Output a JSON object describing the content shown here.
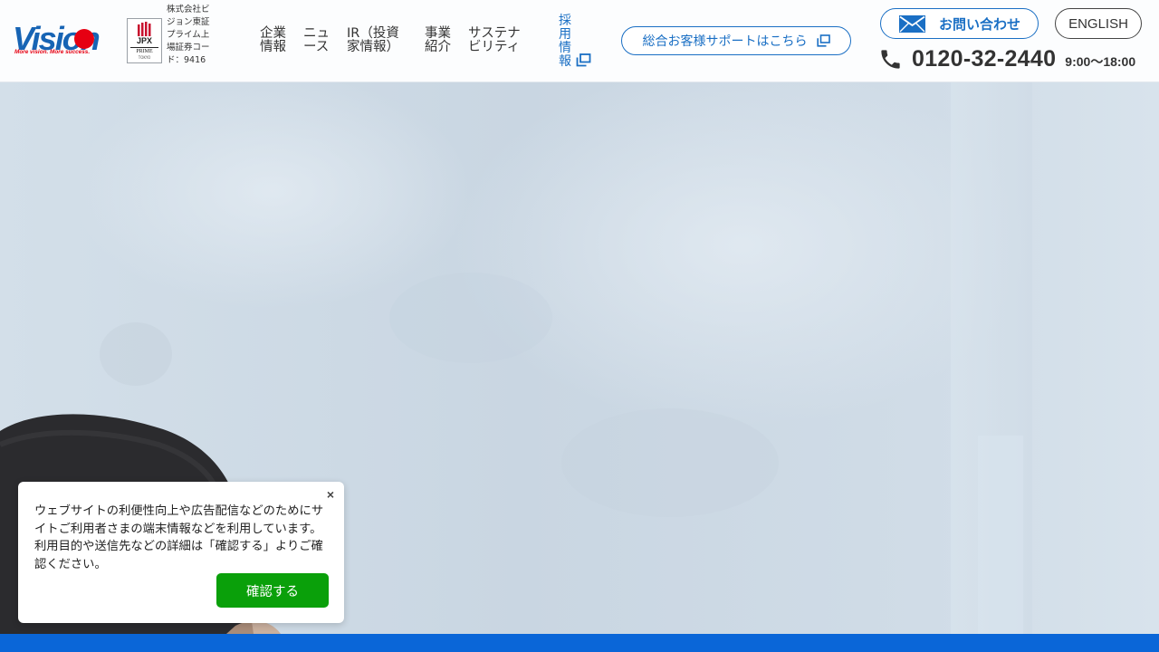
{
  "header": {
    "logo": {
      "wordmark": "Vision",
      "tagline": "More vision. More success."
    },
    "jpx_badge": {
      "label": "JPX",
      "market": "PRIME",
      "exchange": "TOKYO"
    },
    "company_info": "株式会社ビジョン東証プライム上場証券コード：9416",
    "nav": {
      "corporate": "企業情報",
      "news": "ニュース",
      "ir": "IR（投資家情報）",
      "business": "事業紹介",
      "sustainability": "サステナビリティ",
      "recruit": "採用情報"
    },
    "support_button": "総合お客様サポートはこちら",
    "contact_button": "お問い合わせ",
    "english_button": "ENGLISH",
    "phone": {
      "number": "0120-32-2440",
      "hours": "9:00〜18:00"
    }
  },
  "cookie_banner": {
    "message": "ウェブサイトの利便性向上や広告配信などのためにサイトご利用者さまの端末情報などを利用しています。利用目的や送信先などの詳細は「確認する」よりご確認ください。",
    "close_label": "×",
    "confirm_label": "確認する"
  },
  "colors": {
    "brand_blue": "#1a6fc4",
    "brand_red": "#e60012",
    "accent_bar": "#0a66d8",
    "confirm_green": "#0aa00a"
  },
  "icons": {
    "external": "external-link-icon",
    "mail": "mail-icon",
    "phone": "phone-icon",
    "close": "close-icon"
  }
}
